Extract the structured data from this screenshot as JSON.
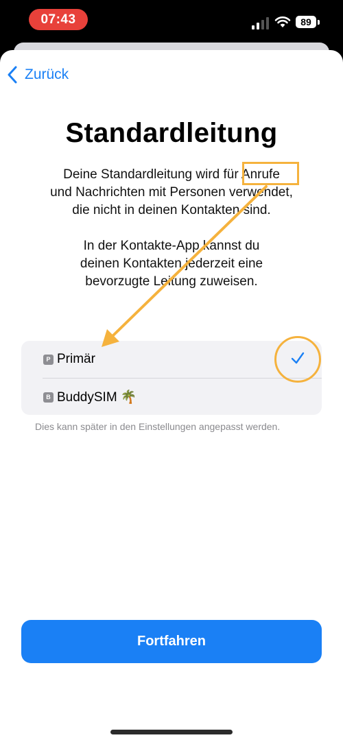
{
  "status_bar": {
    "time": "07:43",
    "battery": "89"
  },
  "nav": {
    "back_label": "Zurück"
  },
  "title": "Standardleitung",
  "paragraph_1": [
    "Deine Standardleitung wird für Anrufe",
    "und Nachrichten mit Personen verwendet,",
    "die nicht in deinen Kontakten sind."
  ],
  "paragraph_2": [
    "In der Kontakte-App kannst du",
    "deinen Kontakten jederzeit eine",
    "bevorzugte Leitung zuweisen."
  ],
  "lines": [
    {
      "badge": "P",
      "label": "Primär",
      "selected": true
    },
    {
      "badge": "B",
      "label": "BuddySIM 🌴",
      "selected": false
    }
  ],
  "footnote": "Dies kann später in den Einstellungen angepasst werden.",
  "continue_label": "Fortfahren",
  "colors": {
    "accent": "#1a80f5",
    "annotation": "#f5b23d",
    "status_time_bg": "#e8413a"
  }
}
